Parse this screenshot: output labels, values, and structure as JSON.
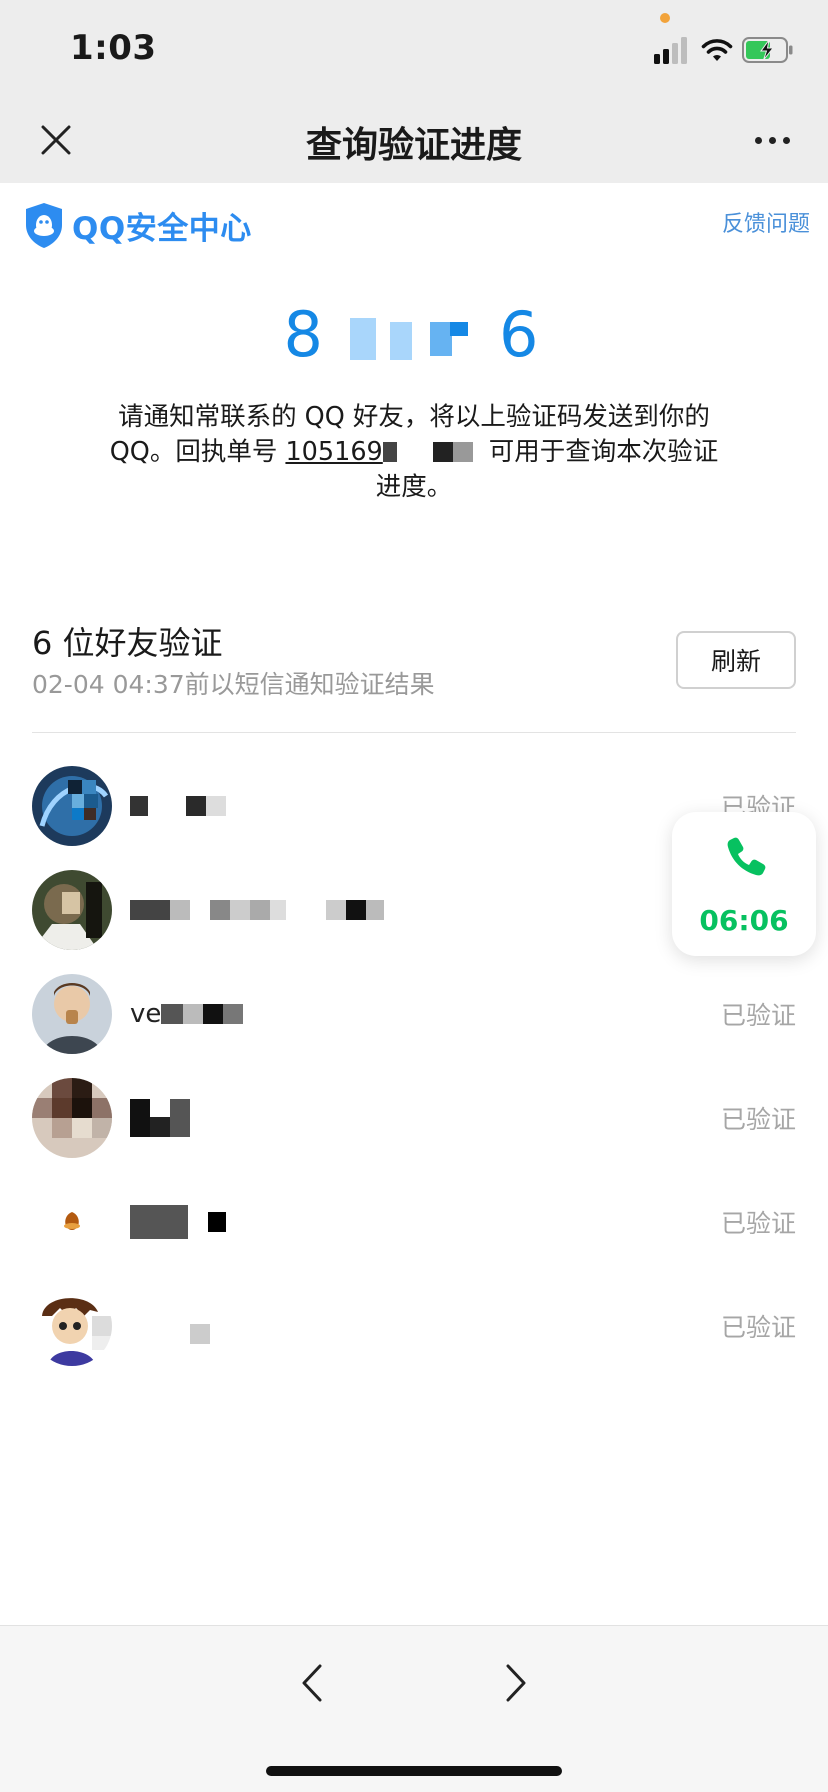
{
  "status_bar": {
    "time": "1:03"
  },
  "nav": {
    "title": "查询验证进度"
  },
  "brand": {
    "name": "QQ安全中心",
    "feedback": "反馈问题"
  },
  "code": {
    "value": "8",
    "value_tail": "6"
  },
  "notice": {
    "line_a": "请通知常联系的 QQ 好友，将以上验证码发送到你的 QQ。回执单号 ",
    "ticket": "105169",
    "line_b": "可用于查询本次验证进度。"
  },
  "section": {
    "title": "6 位好友验证",
    "subtitle": "02-04 04:37前以短信通知验证结果",
    "refresh": "刷新"
  },
  "friends": [
    {
      "name": "",
      "status": "已验证"
    },
    {
      "name": "",
      "status": ""
    },
    {
      "name": "ve",
      "status": "已验证"
    },
    {
      "name": "",
      "status": "已验证"
    },
    {
      "name": "",
      "status": "已验证"
    },
    {
      "name": "",
      "status": "已验证"
    }
  ],
  "call": {
    "timer": "06:06",
    "icon": "phone-icon"
  },
  "colors": {
    "accent": "#1588e5",
    "call_green": "#07c160",
    "status_gray": "#a6a6a6"
  }
}
